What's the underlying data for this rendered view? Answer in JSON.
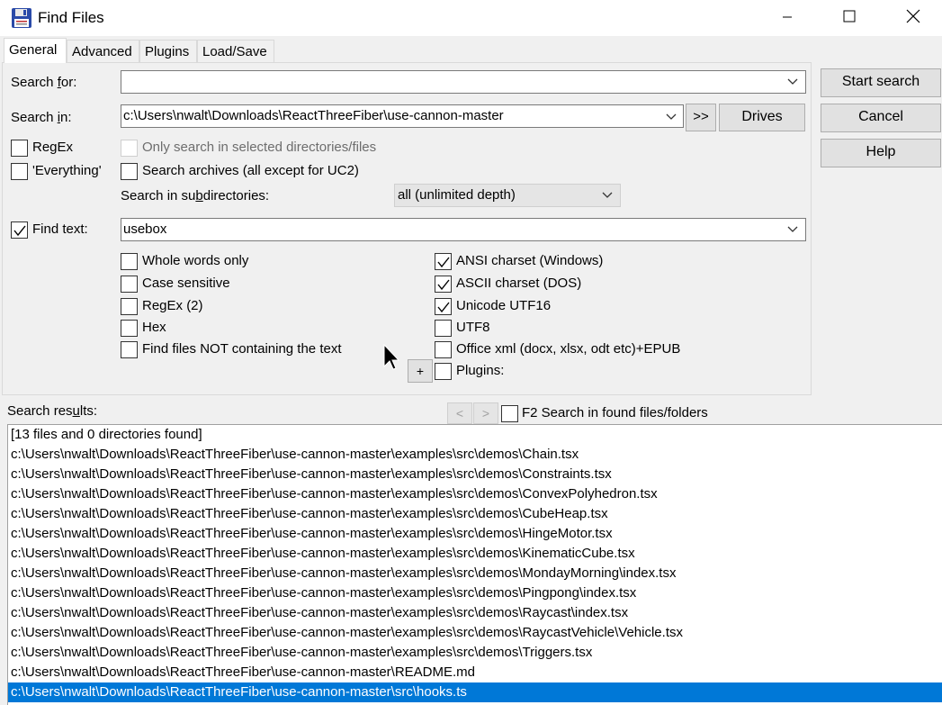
{
  "window": {
    "title": "Find Files"
  },
  "tabs": [
    {
      "label": "General"
    },
    {
      "label": "Advanced"
    },
    {
      "label": "Plugins"
    },
    {
      "label": "Load/Save"
    }
  ],
  "search_for": {
    "label_pre": "Search ",
    "label_u": "f",
    "label_post": "or:",
    "value": ""
  },
  "search_in": {
    "label_pre": "Search ",
    "label_u": "i",
    "label_post": "n:",
    "value": "c:\\Users\\nwalt\\Downloads\\ReactThreeFiber\\use-cannon-master",
    "browse_label": ">>",
    "drives_label": "Drives"
  },
  "options_left": {
    "regex_label": "RegEx",
    "everything_label": "'Everything'"
  },
  "options_mid": {
    "only_selected_label": "Only search in selected directories/files",
    "archives_label": "Search archives (all except for UC2)",
    "subdirs_label_pre": "Search in su",
    "subdirs_label_u": "b",
    "subdirs_label_post": "directories:",
    "subdirs_value": "all (unlimited depth)"
  },
  "find_text": {
    "label": "Find text:",
    "checked": true,
    "value": "usebox"
  },
  "text_options_left": [
    {
      "label": "Whole words only",
      "checked": false
    },
    {
      "label": "Case sensitive",
      "checked": false
    },
    {
      "label": "RegEx (2)",
      "checked": false
    },
    {
      "label": "Hex",
      "checked": false
    },
    {
      "label": "Find files NOT containing the text",
      "checked": false
    }
  ],
  "text_options_right": [
    {
      "label": "ANSI charset (Windows)",
      "checked": true
    },
    {
      "label": "ASCII charset (DOS)",
      "checked": true
    },
    {
      "label": "Unicode UTF16",
      "checked": true
    },
    {
      "label": "UTF8",
      "checked": false
    },
    {
      "label": "Office xml (docx, xlsx, odt etc)+EPUB",
      "checked": false
    },
    {
      "label": "Plugins:",
      "checked": false
    }
  ],
  "plus_label": "+",
  "side_buttons": {
    "start": "Start search",
    "cancel": "Cancel",
    "help": "Help"
  },
  "results": {
    "label_pre": "Search res",
    "label_u": "u",
    "label_post": "lts:",
    "prev": "<",
    "next": ">",
    "f2_label": "F2 Search in found files/folders",
    "items": [
      "[13 files and 0 directories found]",
      "c:\\Users\\nwalt\\Downloads\\ReactThreeFiber\\use-cannon-master\\examples\\src\\demos\\Chain.tsx",
      "c:\\Users\\nwalt\\Downloads\\ReactThreeFiber\\use-cannon-master\\examples\\src\\demos\\Constraints.tsx",
      "c:\\Users\\nwalt\\Downloads\\ReactThreeFiber\\use-cannon-master\\examples\\src\\demos\\ConvexPolyhedron.tsx",
      "c:\\Users\\nwalt\\Downloads\\ReactThreeFiber\\use-cannon-master\\examples\\src\\demos\\CubeHeap.tsx",
      "c:\\Users\\nwalt\\Downloads\\ReactThreeFiber\\use-cannon-master\\examples\\src\\demos\\HingeMotor.tsx",
      "c:\\Users\\nwalt\\Downloads\\ReactThreeFiber\\use-cannon-master\\examples\\src\\demos\\KinematicCube.tsx",
      "c:\\Users\\nwalt\\Downloads\\ReactThreeFiber\\use-cannon-master\\examples\\src\\demos\\MondayMorning\\index.tsx",
      "c:\\Users\\nwalt\\Downloads\\ReactThreeFiber\\use-cannon-master\\examples\\src\\demos\\Pingpong\\index.tsx",
      "c:\\Users\\nwalt\\Downloads\\ReactThreeFiber\\use-cannon-master\\examples\\src\\demos\\Raycast\\index.tsx",
      "c:\\Users\\nwalt\\Downloads\\ReactThreeFiber\\use-cannon-master\\examples\\src\\demos\\RaycastVehicle\\Vehicle.tsx",
      "c:\\Users\\nwalt\\Downloads\\ReactThreeFiber\\use-cannon-master\\examples\\src\\demos\\Triggers.tsx",
      "c:\\Users\\nwalt\\Downloads\\ReactThreeFiber\\use-cannon-master\\README.md",
      "c:\\Users\\nwalt\\Downloads\\ReactThreeFiber\\use-cannon-master\\src\\hooks.ts"
    ],
    "selected_index": 13
  },
  "colors": {
    "selection": "#0078d7",
    "panel_bg": "#f0f0f0"
  }
}
